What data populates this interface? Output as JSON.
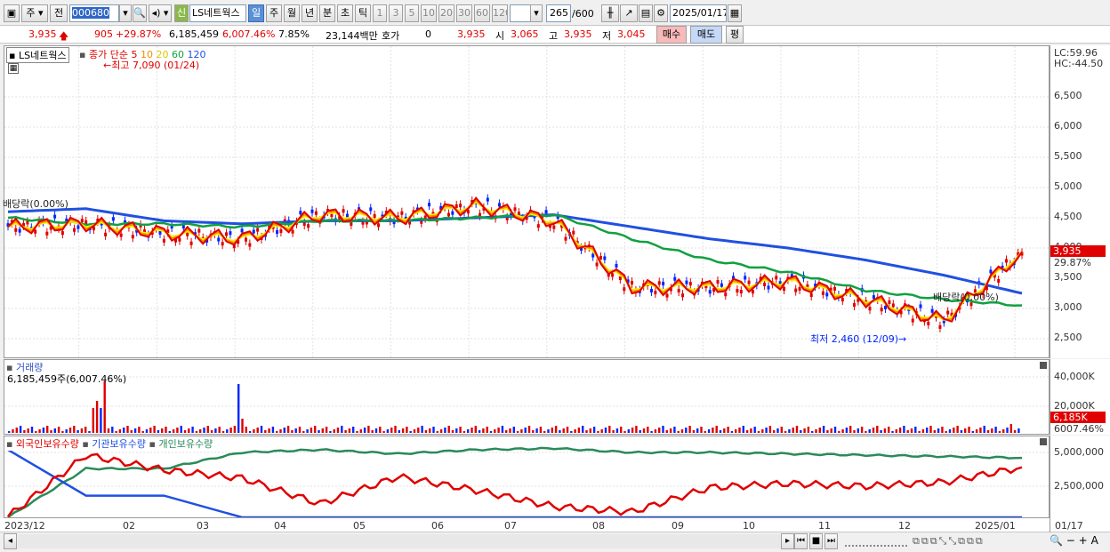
{
  "toolbar": {
    "mode": "주",
    "prev": "전",
    "code": "000680",
    "name": "LS네트웍스",
    "credit": "신",
    "periods": [
      "일",
      "주",
      "월",
      "년",
      "분",
      "초",
      "틱"
    ],
    "minutes": [
      "1",
      "3",
      "5",
      "10",
      "20",
      "30",
      "60",
      "120"
    ],
    "count": "265",
    "total": "/600",
    "date": "2025/01/17"
  },
  "quote": {
    "price": "3,935",
    "change": "905",
    "change_pct": "+29.87%",
    "volume": "6,185,459",
    "volume_pct": "6,007.46%",
    "turnover": "7.85%",
    "amount": "23,144백만",
    "hoga_label": "호가",
    "hoga": "0",
    "ask": "3,935",
    "open_label": "시",
    "open": "3,065",
    "high_label": "고",
    "high": "3,935",
    "low_label": "저",
    "low": "3,045",
    "buy_label": "매수",
    "sell_label": "매도",
    "eval_label": "평"
  },
  "price_pane": {
    "legend_name": "LS네트웍스",
    "legend_type": "종가 단순",
    "ma": [
      "5",
      "10",
      "20",
      "60",
      "120"
    ],
    "high_note": "최고 7,090 (01/24)",
    "low_note": "최저 2,460 (12/09)",
    "div_left": "배당락(0.00%)",
    "div_right": "배당락(0.00%)",
    "lc": "LC:59.96",
    "hc": "HC:-44.50",
    "price_tag": "3,935",
    "pct_tag": "29.87%",
    "ticks": [
      "6,500",
      "6,000",
      "5,500",
      "5,000",
      "4,500",
      "4,000",
      "3,500",
      "3,000",
      "2,500"
    ]
  },
  "volume_pane": {
    "title": "거래량",
    "value": "6,185,459주(6,007.46%)",
    "ticks": [
      "40,000K",
      "20,000K"
    ],
    "tag": "6,185K",
    "pct": "6007.46%"
  },
  "holding_pane": {
    "legend": [
      "외국인보유수량",
      "기관보유수량",
      "개인보유수량"
    ],
    "ticks": [
      "5,000,000",
      "2,500,000"
    ]
  },
  "xaxis": {
    "labels": [
      "2023/12",
      "02",
      "03",
      "04",
      "05",
      "06",
      "07",
      "08",
      "09",
      "10",
      "11",
      "12",
      "2025/01"
    ],
    "right": "01/17"
  },
  "colors": {
    "ma5": "#e00000",
    "ma10": "#f09000",
    "ma20": "#f8f000",
    "ma60": "#10a040",
    "ma120": "#2050e0",
    "up": "#e00000",
    "down": "#0026ff"
  },
  "chart_data": {
    "type": "line",
    "x": [
      "2023-12",
      "2024-01",
      "2024-02",
      "2024-03",
      "2024-04",
      "2024-05",
      "2024-06",
      "2024-07",
      "2024-08",
      "2024-09",
      "2024-10",
      "2024-11",
      "2024-12",
      "2025-01"
    ],
    "series": [
      {
        "name": "종가",
        "values": [
          4350,
          4400,
          4250,
          4150,
          4550,
          4500,
          4700,
          4450,
          3350,
          3350,
          3450,
          3150,
          2800,
          3935
        ]
      },
      {
        "name": "120",
        "values": [
          4600,
          4650,
          4450,
          4400,
          4450,
          4450,
          4500,
          4550,
          4350,
          4150,
          4000,
          3800,
          3550,
          3250
        ]
      },
      {
        "name": "60",
        "values": [
          4500,
          4400,
          4400,
          4350,
          4450,
          4450,
          4500,
          4550,
          4150,
          3800,
          3600,
          3300,
          3150,
          3050
        ]
      },
      {
        "name": "외국인보유수량",
        "values": [
          250000,
          4800000,
          3700000,
          3100000,
          1200000,
          3200000,
          2200000,
          1000000,
          600000,
          2400000,
          2700000,
          2500000,
          2800000,
          3900000
        ]
      },
      {
        "name": "기관보유수량",
        "values": [
          5200000,
          1800000,
          1800000,
          200000,
          200000,
          200000,
          200000,
          200000,
          200000,
          200000,
          200000,
          200000,
          200000,
          200000
        ]
      },
      {
        "name": "개인보유수량",
        "values": [
          200000,
          3800000,
          3800000,
          5000000,
          5200000,
          4900000,
          5200000,
          5300000,
          5000000,
          5000000,
          4900000,
          4800000,
          4700000,
          4600000
        ]
      }
    ],
    "ylim": [
      2300,
      7100
    ]
  }
}
